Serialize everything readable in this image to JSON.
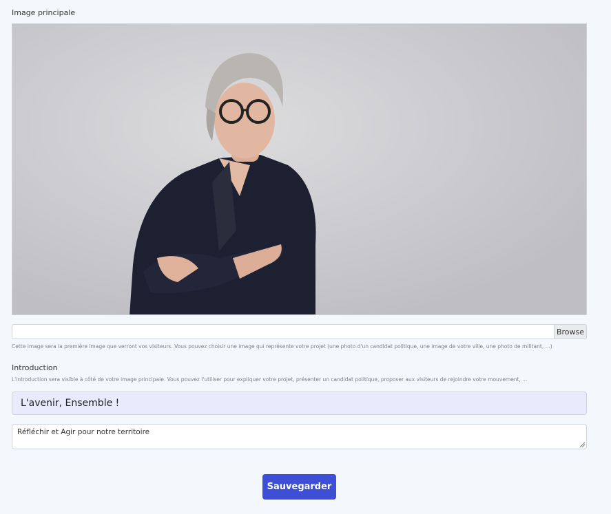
{
  "image_section": {
    "label": "Image principale",
    "browse_label": "Browse",
    "file_value": "",
    "help": "Cette image sera la première image que verront vos visiteurs. Vous pouvez choisir une image qui représente votre projet (une photo d'un candidat politique, une image de votre ville, une photo de militant, ...)"
  },
  "intro_section": {
    "label": "Introduction",
    "help": "L'introduction sera visible à côté de votre image principale. Vous pouvez l'utiliser pour expliquer votre projet, présenter un candidat politique, proposer aux visiteurs de rejoindre votre mouvement, ...",
    "title_value": "L'avenir, Ensemble !",
    "text_value": "Réfléchir et Agir pour notre territoire"
  },
  "actions": {
    "save_label": "Sauvegarder"
  },
  "colors": {
    "primary": "#3d4fd4",
    "page_background": "#f4f7fb",
    "title_input_background": "#e8ebfb"
  }
}
